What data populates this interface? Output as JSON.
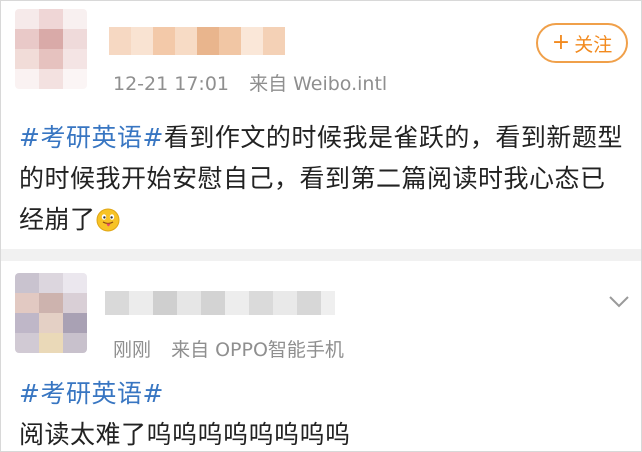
{
  "post1": {
    "time": "12-21 17:01",
    "source": "来自 Weibo.intl",
    "follow_label": "关注",
    "follow_plus": "+",
    "hashtag": "#考研英语#",
    "text": "看到作文的时候我是雀跃的，看到新题型的时候我开始安慰自己，看到第二篇阅读时我心态已经崩了",
    "emoji": "tongue-out-emoji"
  },
  "post2": {
    "time": "刚刚",
    "source": "来自 OPPO智能手机",
    "hashtag": "#考研英语#",
    "text": "阅读太难了呜呜呜呜呜呜呜呜",
    "chevron": "chevron-down-icon"
  },
  "colors": {
    "tag": "#3876c2",
    "follow": "#f28a1e",
    "meta": "#8f8f8f",
    "separator": "#f1f1f1"
  }
}
